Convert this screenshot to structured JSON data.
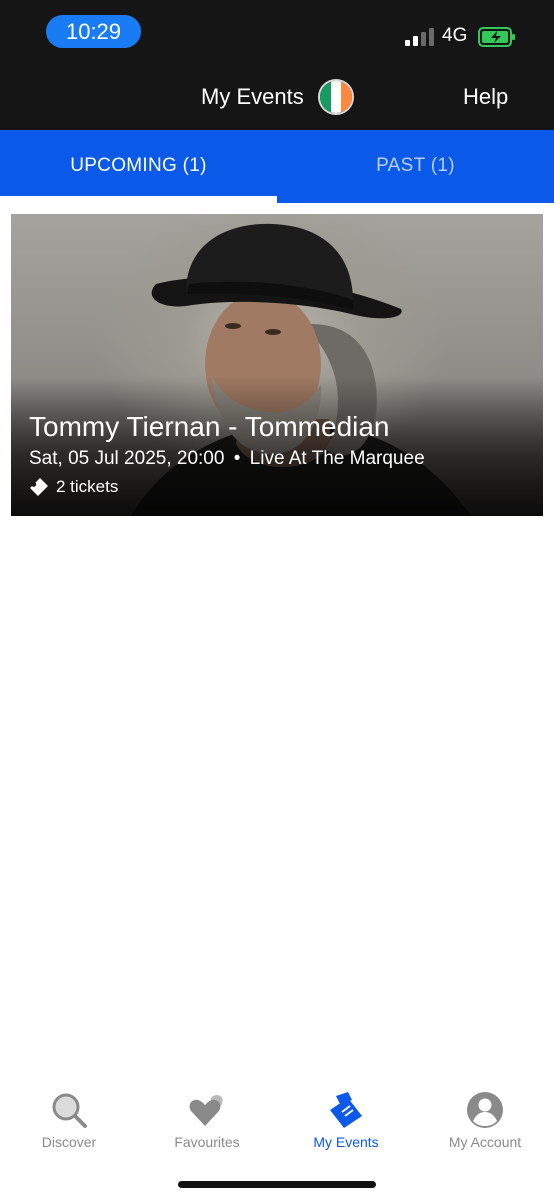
{
  "status_bar": {
    "time": "10:29",
    "network": "4G",
    "time_pill_color": "#1a7cf5",
    "battery_color": "#34c759"
  },
  "header": {
    "title": "My Events",
    "help_label": "Help",
    "flag_colors": [
      "#169b62",
      "#ffffff",
      "#ff883e"
    ]
  },
  "tabs": [
    {
      "label": "UPCOMING (1)",
      "active": true
    },
    {
      "label": "PAST (1)",
      "active": false
    }
  ],
  "event": {
    "title": "Tommy Tiernan - Tommedian",
    "datetime": "Sat, 05 Jul 2025, 20:00",
    "separator": "•",
    "venue": "Live At The Marquee",
    "tickets": "2 tickets"
  },
  "bottom_nav": [
    {
      "label": "Discover",
      "icon": "magnifier-icon",
      "active": false
    },
    {
      "label": "Favourites",
      "icon": "hearts-icon",
      "active": false
    },
    {
      "label": "My Events",
      "icon": "tickets-icon",
      "active": true
    },
    {
      "label": "My Account",
      "icon": "user-icon",
      "active": false
    }
  ],
  "colors": {
    "brand_blue": "#0a59e8",
    "dark_bar": "#151515",
    "inactive_gray": "#8a8a8a"
  }
}
